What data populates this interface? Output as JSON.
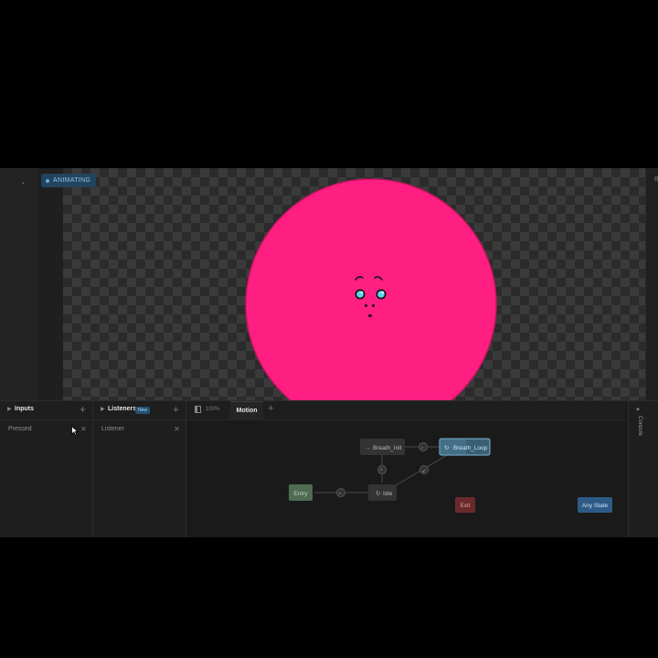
{
  "stage": {
    "status_badge": "ANIMATING",
    "right_strip_letter": "B",
    "character": {
      "body_color": "#ff1f83",
      "outline_color": "#c8155f"
    }
  },
  "inputs_panel": {
    "title": "Inputs",
    "items": [
      {
        "label": "Pressed"
      }
    ]
  },
  "listeners_panel": {
    "title": "Listeners",
    "badge": "New",
    "items": [
      {
        "label": "Listener"
      }
    ]
  },
  "graph_panel": {
    "zoom": "100%",
    "tabs": [
      {
        "label": "Motion"
      }
    ],
    "states": {
      "entry": "Entry",
      "idle": "Idle",
      "breath_init": "Breath_Init",
      "breath_loop": "Breath_Loop",
      "exit": "Exit",
      "any_state": "Any State"
    },
    "colors": {
      "entry": "#4f6b52",
      "exit": "#6a2a2c",
      "any_state": "#2e5a86",
      "selected": "#3a5f73"
    }
  },
  "console": {
    "title": "Console"
  }
}
